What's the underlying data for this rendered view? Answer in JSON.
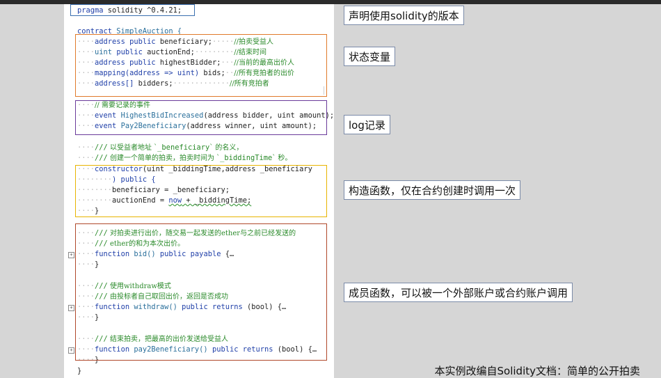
{
  "annotations": {
    "pragma": "声明使用solidity的版本",
    "state": "状态变量",
    "log": "log记录",
    "constructor": "构造函数，仅在合约创建时调用一次",
    "members": "成员函数，可以被一个外部账户或合约账户调用"
  },
  "footer": "本实例改编自Solidity文档：简单的公开拍卖",
  "colors": {
    "pragma_box": "#3a6fb0",
    "state_box": "#e07a2a",
    "log_box": "#6a3a9a",
    "constructor_box": "#e8b400",
    "members_box": "#b0482a"
  },
  "code": {
    "pragma": {
      "kw": "pragma",
      "rest": " solidity ^0.4.21;"
    },
    "contract": {
      "kw": "contract",
      "name": " SimpleAuction {"
    },
    "state_vars": [
      {
        "type": "address",
        "mod": " public",
        "name": " beneficiary;",
        "comment": "//拍卖受益人"
      },
      {
        "type": "uint",
        "mod": " public",
        "name": " auctionEnd;",
        "comment": "//结束时间"
      },
      {
        "type": "address",
        "mod": " public",
        "name": " highestBidder;",
        "comment": "//当前的最高出价人"
      },
      {
        "type": "mapping(address => uint)",
        "mod": "",
        "name": " bids;",
        "comment": "//所有竞拍者的出价"
      },
      {
        "type": "address[]",
        "mod": "",
        "name": " bidders;",
        "comment": "//所有竞拍者"
      }
    ],
    "events_comment": "// 需要记录的事件",
    "event1": {
      "kw": "event",
      "name": " HighestBidIncreased",
      "args": "(address bidder, uint amount);"
    },
    "event2": {
      "kw": "event",
      "name": " Pay2Beneficiary",
      "args": "(address winner, uint amount);"
    },
    "ctor_comment1": {
      "slashes": "///",
      "text": " 以受益者地址 `",
      "var": "_beneficiary",
      "tail": "` 的名义，"
    },
    "ctor_comment2": {
      "slashes": "///",
      "text": " 创建一个简单的拍卖，拍卖时间为 `",
      "var": "_biddingTime",
      "tail": "` 秒。"
    },
    "ctor_sig": {
      "kw": "constructor",
      "args": "(uint _biddingTime,address _beneficiary"
    },
    "ctor_public": ") public {",
    "ctor_body1": "beneficiary = _beneficiary;",
    "ctor_body2a": "auctionEnd = ",
    "ctor_body2b": "now",
    "ctor_body2c": " + _biddingTime;",
    "close": "}",
    "bid_comment1": {
      "slashes": "///",
      "text": " 对拍卖进行出价，随交易一起发送的ether与之前已经发送的"
    },
    "bid_comment2": {
      "slashes": "///",
      "text": " ether的和为本次出价。"
    },
    "bid_sig": {
      "kw": "function",
      "name": " bid()",
      "mods": " public payable",
      "tail": " {…"
    },
    "wd_comment1": {
      "slashes": "///",
      "text": " 使用withdraw模式"
    },
    "wd_comment2": {
      "slashes": "///",
      "text": " 由投标者自己取回出价，返回是否成功"
    },
    "wd_sig": {
      "kw": "function",
      "name": " withdraw()",
      "mods": " public returns",
      "tail": " (bool) {…"
    },
    "pay_comment": {
      "slashes": "///",
      "text": " 结束拍卖，把最高的出价发送给受益人"
    },
    "pay_sig": {
      "kw": "function",
      "name": " pay2Beneficiary()",
      "mods": " public returns",
      "tail": " (bool) {…"
    },
    "fold_mark": "+"
  }
}
